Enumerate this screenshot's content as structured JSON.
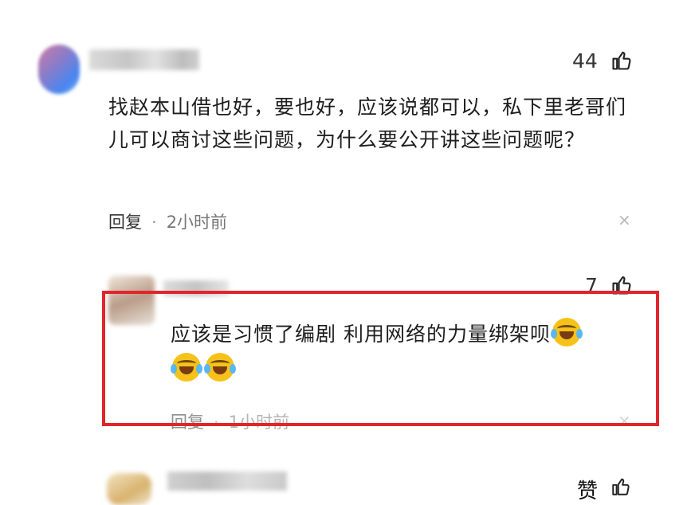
{
  "comment": {
    "like_count": "44",
    "text": "找赵本山借也好，要也好，应该说都可以，私下里老哥们儿可以商讨这些问题，为什么要公开讲这些问题呢？",
    "reply_label": "回复",
    "time": "2小时前",
    "close_glyph": "×"
  },
  "reply": {
    "like_count": "7",
    "text": "应该是习惯了编剧 利用网络的力量绑架呗",
    "emoji_name": "laughing-with-tears",
    "reply_label": "回复",
    "time": "1小时前",
    "close_glyph": "×",
    "highlight_color": "#e0262b"
  },
  "bottom": {
    "like_label": "赞"
  },
  "colors": {
    "text": "#1e1e1e",
    "meta": "#777777",
    "highlight": "#e0262b"
  }
}
